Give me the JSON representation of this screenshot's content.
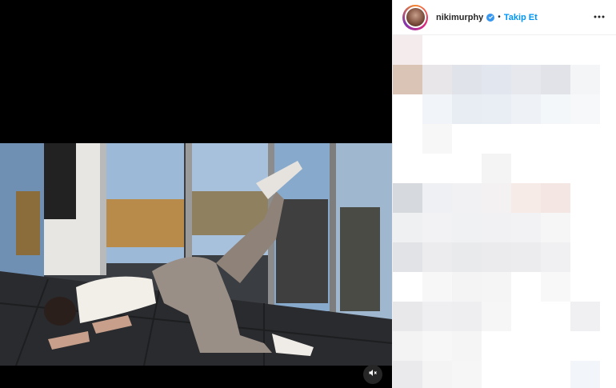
{
  "header": {
    "username": "nikimurphy",
    "separator": "•",
    "follow_label": "Takip Et"
  },
  "icons": {
    "verified": "verified-badge-icon",
    "more": "more-options-icon",
    "mute": "muted-speaker-icon"
  },
  "colors": {
    "follow": "#0095f6",
    "verified": "#3897f0",
    "media_background": "#000000"
  }
}
